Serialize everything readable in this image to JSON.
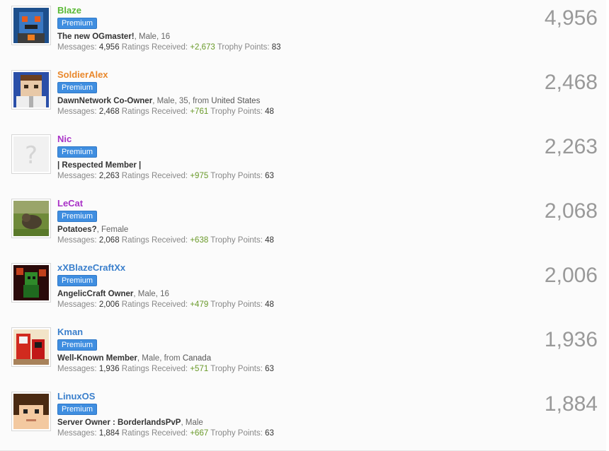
{
  "labels": {
    "messages": "Messages:",
    "ratings": "Ratings Received:",
    "trophy": "Trophy Points:",
    "from": "from"
  },
  "members": [
    {
      "username": "Blaze",
      "name_color": "#59b935",
      "badge": "Premium",
      "user_title": "The new OGmaster!",
      "details": ", Male, 16",
      "location": "",
      "messages": "4,956",
      "ratings": "+2,673",
      "trophy": "83",
      "count": "4,956",
      "avatar": "blaze-avatar"
    },
    {
      "username": "SoldierAlex",
      "name_color": "#e9882c",
      "badge": "Premium",
      "user_title": "DawnNetwork Co-Owner",
      "details": ", Male, 35, ",
      "location": "United States",
      "messages": "2,468",
      "ratings": "+761",
      "trophy": "48",
      "count": "2,468",
      "avatar": "soldieralex-avatar"
    },
    {
      "username": "Nic",
      "name_color": "#a932c7",
      "badge": "Premium",
      "user_title": "| Respected Member |",
      "details": "",
      "location": "",
      "messages": "2,263",
      "ratings": "+975",
      "trophy": "63",
      "count": "2,263",
      "avatar": "default-avatar"
    },
    {
      "username": "LeCat",
      "name_color": "#a932c7",
      "badge": "Premium",
      "user_title": "Potatoes?",
      "details": ", Female",
      "location": "",
      "messages": "2,068",
      "ratings": "+638",
      "trophy": "48",
      "count": "2,068",
      "avatar": "lecat-avatar"
    },
    {
      "username": "xXBlazeCraftXx",
      "name_color": "#3a7fcc",
      "badge": "Premium",
      "user_title": "AngelicCraft Owner",
      "details": ", Male, 16",
      "location": "",
      "messages": "2,006",
      "ratings": "+479",
      "trophy": "48",
      "count": "2,006",
      "avatar": "xxblazecraftxx-avatar"
    },
    {
      "username": "Kman",
      "name_color": "#3a7fcc",
      "badge": "Premium",
      "user_title": "Well-Known Member",
      "details": ", Male, ",
      "location": "Canada",
      "messages": "1,936",
      "ratings": "+571",
      "trophy": "63",
      "count": "1,936",
      "avatar": "kman-avatar"
    },
    {
      "username": "LinuxOS",
      "name_color": "#3a7fcc",
      "badge": "Premium",
      "user_title": "Server Owner : BorderlandsPvP",
      "details": ", Male",
      "location": "",
      "messages": "1,884",
      "ratings": "+667",
      "trophy": "63",
      "count": "1,884",
      "avatar": "linuxos-avatar"
    }
  ]
}
